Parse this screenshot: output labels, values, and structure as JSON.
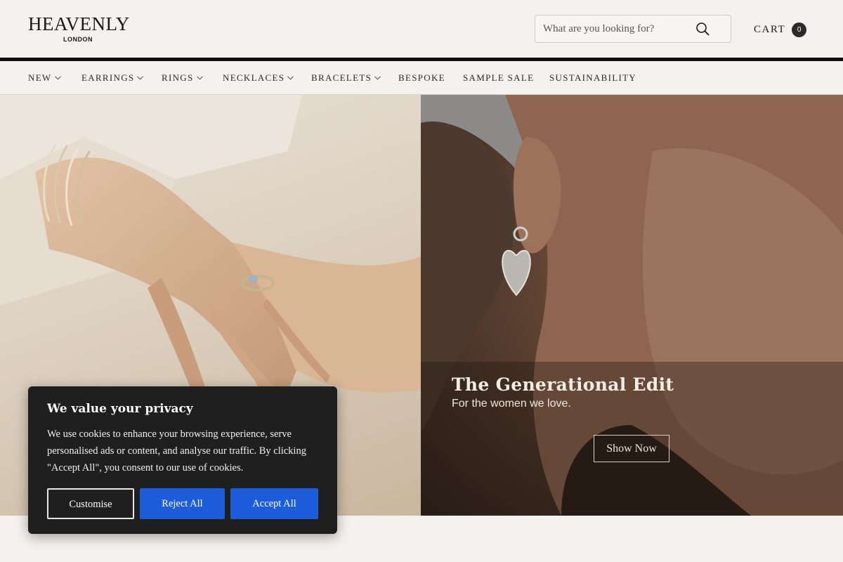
{
  "brand": {
    "name": "HEAVENLY",
    "location": "LONDON"
  },
  "search": {
    "placeholder": "What are you looking for?",
    "icon": "search-icon"
  },
  "cart": {
    "label": "CART",
    "count": "0"
  },
  "nav": {
    "items": [
      {
        "label": "NEW",
        "has_dropdown": true
      },
      {
        "label": "EARRINGS",
        "has_dropdown": true
      },
      {
        "label": "RINGS",
        "has_dropdown": true
      },
      {
        "label": "NECKLACES",
        "has_dropdown": true
      },
      {
        "label": "BRACELETS",
        "has_dropdown": true
      },
      {
        "label": "BESPOKE",
        "has_dropdown": false
      },
      {
        "label": "SAMPLE SALE",
        "has_dropdown": false
      },
      {
        "label": "SUSTAINABILITY",
        "has_dropdown": false
      }
    ]
  },
  "hero": {
    "title": "The Generational Edit",
    "subtitle": "For the women we love.",
    "button": "Show Now"
  },
  "cookie": {
    "title": "We value your privacy",
    "text": "We use cookies to enhance your browsing experience, serve personalised ads or content, and analyse our traffic. By clicking \"Accept All\", you consent to our use of cookies.",
    "customise": "Customise",
    "reject": "Reject All",
    "accept": "Accept All"
  },
  "colors": {
    "background": "#f4f2ee",
    "accent_blue": "#1d5ddb",
    "banner_bg": "#1f1f1f",
    "header_rule": "#111111"
  }
}
